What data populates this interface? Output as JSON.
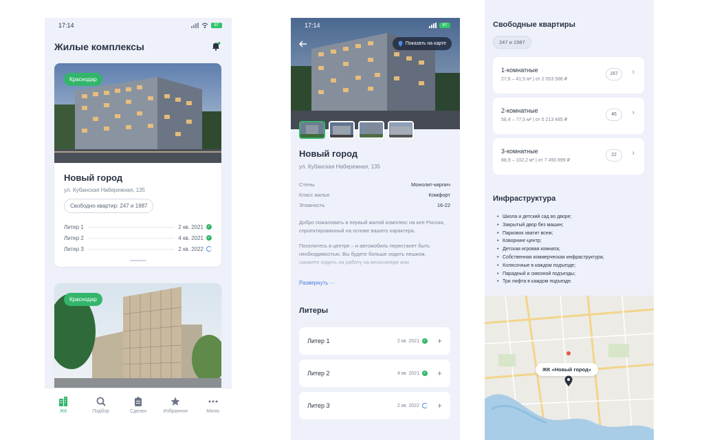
{
  "colors": {
    "accent": "#33b66c",
    "link": "#4a7bd8",
    "text": "#2a3342",
    "muted": "#7c8596",
    "bg": "#eef1fa"
  },
  "status": {
    "time": "17:14",
    "battery": "87"
  },
  "list_screen": {
    "title": "Жилые комплексы",
    "cards": [
      {
        "city": "Краснодар",
        "name": "Новый город",
        "address": "ул. Кубанская Набережная, 135",
        "free_flats": "Свободно квартир: 247 и 1987",
        "liters": [
          {
            "name": "Литер 1",
            "date": "2 кв. 2021",
            "state": "done"
          },
          {
            "name": "Литер 2",
            "date": "4 кв. 2021",
            "state": "done"
          },
          {
            "name": "Литер 3",
            "date": "2 кв. 2022",
            "state": "progress"
          }
        ]
      },
      {
        "city": "Краснодар"
      }
    ],
    "tabs": [
      {
        "label": "ЖК",
        "icon": "buildings-icon",
        "active": true
      },
      {
        "label": "Подбор",
        "icon": "search-icon",
        "active": false
      },
      {
        "label": "Сделки",
        "icon": "clipboard-icon",
        "active": false
      },
      {
        "label": "Избранное",
        "icon": "star-icon",
        "active": false
      },
      {
        "label": "Меню",
        "icon": "more-icon",
        "active": false
      }
    ]
  },
  "detail_screen": {
    "show_on_map": "Показать на карте",
    "name": "Новый город",
    "address": "ул. Кубанская Набережная, 135",
    "specs": [
      {
        "key": "Стены",
        "value": "Монолит-кирпич"
      },
      {
        "key": "Класс жилья",
        "value": "Комфорт"
      },
      {
        "key": "Этажность",
        "value": "16-22"
      }
    ],
    "desc_1": "Добро пожаловать в первый жилой комплекс на юге России, спроектированный на основе вашего характера.",
    "desc_2": "Поселитесь в центре – и автомобиль перестанет быть необходимостью. Вы будете больше ходить пешком, сможете ходить на работу на велосипеде или",
    "expand": "Развернуть ···",
    "liters_title": "Литеры",
    "liters": [
      {
        "name": "Литер 1",
        "date": "2 кв. 2021",
        "state": "done"
      },
      {
        "name": "Литер 2",
        "date": "4 кв. 2021",
        "state": "done"
      },
      {
        "name": "Литер 3",
        "date": "2 кв. 2022",
        "state": "progress"
      }
    ]
  },
  "flats_screen": {
    "title": "Свободные квартиры",
    "pill": "247 и 1987",
    "apartments": [
      {
        "name": "1-комнатные",
        "sub": "27,6 – 41,5 м²  |  от 2 053 586 ₽",
        "count": "167"
      },
      {
        "name": "2-комнатные",
        "sub": "56,4 – 77,5 м²  |  от 5 213 485 ₽",
        "count": "46"
      },
      {
        "name": "3-комнатные",
        "sub": "88,9 – 102,2 м²  |  от 7 450 899 ₽",
        "count": "22"
      }
    ],
    "infra_title": "Инфраструктура",
    "infra": [
      "Школа и детский сад во дворе;",
      "Закрытый двор без машин;",
      "Парковок хватит всем;",
      "Коворнинг-центр;",
      "Детская игровая комната;",
      "Собственная коммерческая инфраструктура;",
      "Колясочные в каждом подъезде;",
      "Парадный и сквозной подъезды;",
      "Три лифта в каждом подъезде."
    ],
    "map_label": "ЖК «Новый город»"
  }
}
